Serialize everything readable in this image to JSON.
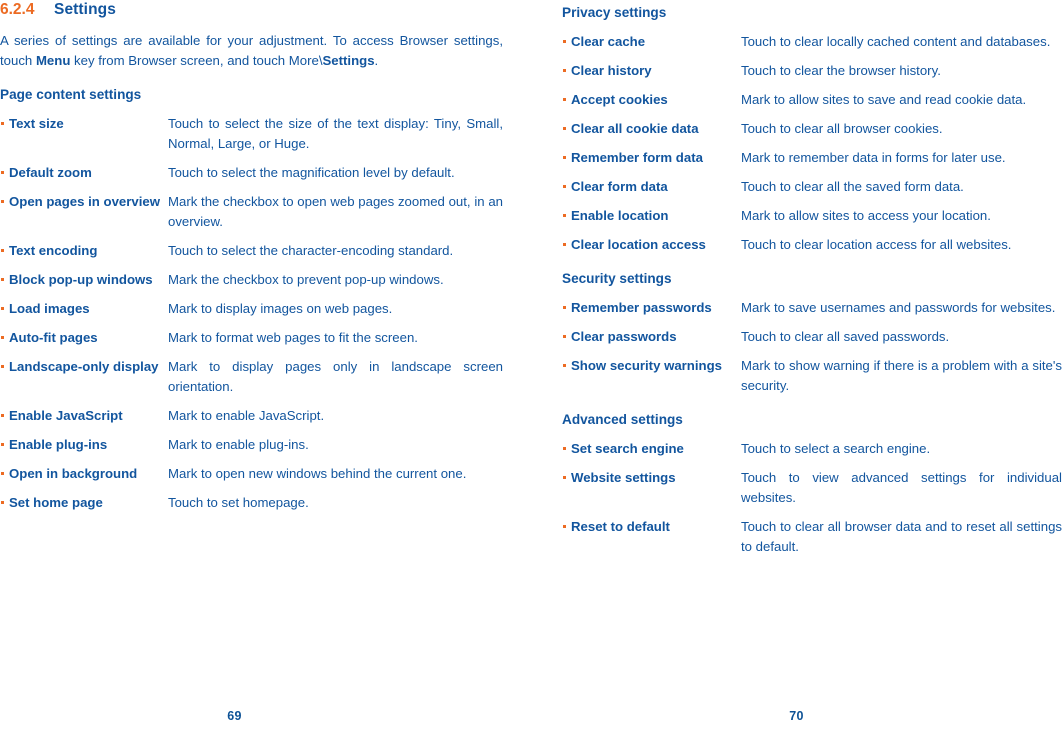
{
  "left_page": {
    "section": {
      "number": "6.2.4",
      "title": "Settings"
    },
    "intro_parts": {
      "p1": "A series of settings are available for your adjustment. To access Browser settings, touch ",
      "b1": "Menu",
      "p2": " key from Browser screen, and touch More\\",
      "b2": "Settings",
      "p3": "."
    },
    "groups": [
      {
        "heading": "Page content settings",
        "rows": [
          {
            "term": "Text size",
            "desc": "Touch to select the size of the text display: Tiny, Small, Normal, Large, or Huge.",
            "justify": true
          },
          {
            "term": "Default zoom",
            "desc": "Touch to select the magnification level by default.",
            "justify": false
          },
          {
            "term": "Open pages in overview",
            "desc": "Mark the checkbox to open web pages zoomed out, in an overview.",
            "justify": true
          },
          {
            "term": "Text encoding",
            "desc": "Touch to select the character-encoding standard.",
            "justify": false
          },
          {
            "term": "Block pop-up windows",
            "desc": "Mark the checkbox to prevent pop-up windows.",
            "justify": false
          },
          {
            "term": "Load images",
            "desc": "Mark to display images on web pages.",
            "justify": false
          },
          {
            "term": "Auto-fit pages",
            "desc": "Mark to format web pages to fit the screen.",
            "justify": false
          },
          {
            "term": "Landscape-only display",
            "desc": "Mark to display pages only in landscape screen orientation.",
            "justify": true
          },
          {
            "term": "Enable JavaScript",
            "desc": "Mark to enable JavaScript.",
            "justify": false
          },
          {
            "term": "Enable plug-ins",
            "desc": "Mark to enable plug-ins.",
            "justify": false
          },
          {
            "term": "Open in background",
            "desc": "Mark to open new windows behind the current one.",
            "justify": false
          },
          {
            "term": "Set home page",
            "desc": "Touch to set homepage.",
            "justify": false
          }
        ]
      }
    ],
    "folio": "69"
  },
  "right_page": {
    "groups": [
      {
        "heading": "Privacy settings",
        "rows": [
          {
            "term": "Clear cache",
            "desc": "Touch to clear locally cached content and databases.",
            "justify": true
          },
          {
            "term": "Clear history",
            "desc": "Touch to clear the browser history.",
            "justify": false
          },
          {
            "term": "Accept cookies",
            "desc": "Mark to allow sites to save and read cookie data.",
            "justify": false
          },
          {
            "term": "Clear all cookie data",
            "desc": "Touch to clear all browser cookies.",
            "justify": false
          },
          {
            "term": "Remember form data",
            "desc": "Mark to remember data in forms for later use.",
            "justify": false
          },
          {
            "term": "Clear form data",
            "desc": "Touch to clear all the saved form data.",
            "justify": false
          },
          {
            "term": "Enable location",
            "desc": "Mark to allow sites to access your location.",
            "justify": false
          },
          {
            "term": "Clear location access",
            "desc": "Touch to clear location access for all websites.",
            "justify": false
          }
        ]
      },
      {
        "heading": "Security settings",
        "rows": [
          {
            "term": "Remember passwords",
            "desc": "Mark to save usernames and passwords for websites.",
            "justify": true
          },
          {
            "term": "Clear passwords",
            "desc": "Touch to clear all saved passwords.",
            "justify": false
          },
          {
            "term": "Show security warnings",
            "desc": "Mark to show warning if there is a problem with a site's security.",
            "justify": true
          }
        ]
      },
      {
        "heading": "Advanced settings",
        "rows": [
          {
            "term": "Set search engine",
            "desc": "Touch to select a search engine.",
            "justify": false
          },
          {
            "term": "Website settings",
            "desc": "Touch to view advanced settings for individual websites.",
            "justify": true
          },
          {
            "term": "Reset to default",
            "desc": "Touch to clear all browser data and to reset all settings to default.",
            "justify": true
          }
        ]
      }
    ],
    "folio": "70"
  },
  "colors": {
    "text_blue": "#12559e",
    "accent_orange": "#ec6b23"
  }
}
